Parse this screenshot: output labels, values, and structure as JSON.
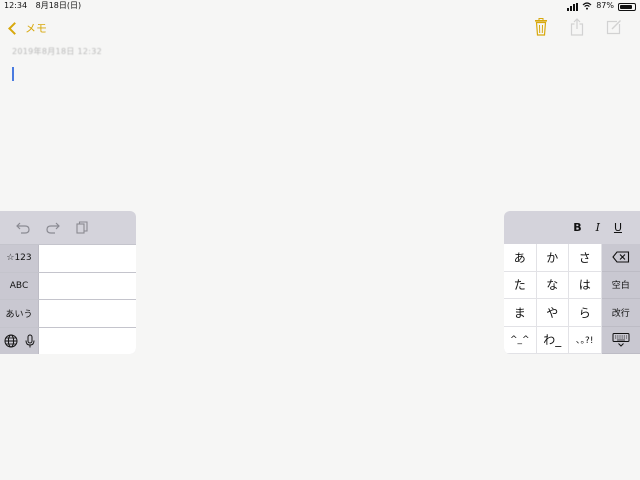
{
  "status": {
    "time": "12:34",
    "date": "8月18日(日)",
    "battery_percent": "87%",
    "battery_level": 0.87
  },
  "nav": {
    "back_label": "メモ",
    "accent_color": "#d8a80c",
    "icons": [
      "trash-icon",
      "share-icon",
      "compose-icon"
    ]
  },
  "note": {
    "date_text": "2019年8月18日 12:32"
  },
  "keyboard_left": {
    "toolbar_icons": [
      "undo-icon",
      "redo-icon",
      "paste-icon"
    ],
    "side_keys": [
      "☆123",
      "ABC",
      "あいう"
    ],
    "bottom_icons": [
      "globe-icon",
      "mic-icon"
    ]
  },
  "keyboard_right": {
    "format_buttons": {
      "bold": "B",
      "italic": "I",
      "underline": "U"
    },
    "kana_rows": [
      [
        "あ",
        "か",
        "さ"
      ],
      [
        "た",
        "な",
        "は"
      ],
      [
        "ま",
        "や",
        "ら"
      ],
      [
        "^_^",
        "わ_",
        "､｡?!"
      ]
    ],
    "func_keys": {
      "delete_icon": "backspace-icon",
      "space": "空白",
      "return": "改行",
      "dismiss_icon": "keyboard-dismiss-icon"
    }
  }
}
